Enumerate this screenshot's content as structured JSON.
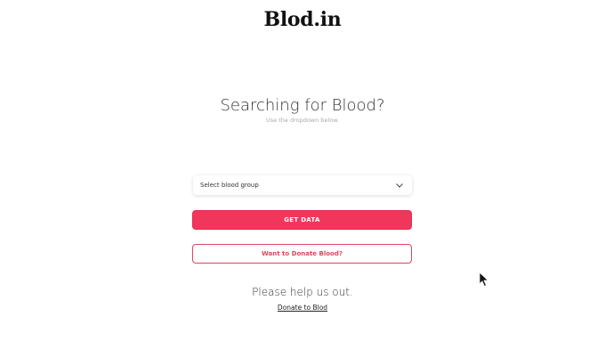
{
  "brand": {
    "name": "Blod.in"
  },
  "hero": {
    "title": "Searching for Blood?",
    "subtitle": "Use the dropdown below."
  },
  "form": {
    "blood_group_select": {
      "placeholder": "Select blood group",
      "icon": "chevron-down-icon"
    },
    "get_data_label": "GET DATA",
    "donate_blood_label": "Want to Donate Blood?"
  },
  "footer": {
    "help_text": "Please help us out.",
    "donate_link_label": "Donate to Blod"
  },
  "colors": {
    "accent": "#f0375b",
    "outline": "#e0455f",
    "text": "#222222",
    "background": "#ffffff"
  },
  "pointer": {
    "icon": "mouse-pointer-icon"
  }
}
